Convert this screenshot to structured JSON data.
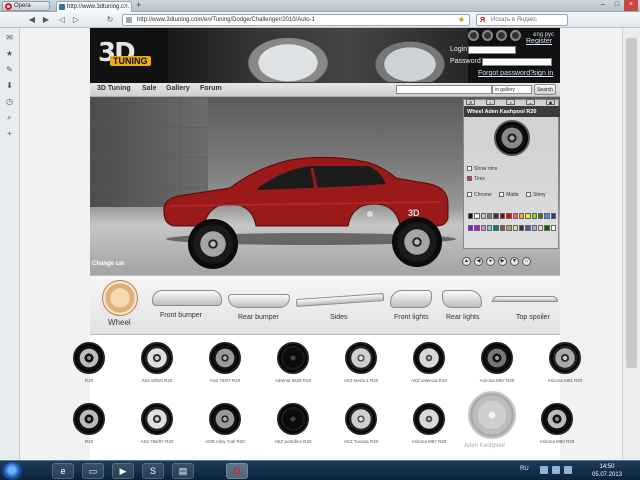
{
  "browser": {
    "menu_label": "Opera",
    "tab_title": "http://www.3dtuning.c...",
    "tab_close": "×",
    "new_tab": "+",
    "url": "http://www.3dtuning.com/en/Tuning/Dodge/Challenger/2010/Auto-1",
    "search_placeholder": "Искать в Яндекс",
    "win_min": "–",
    "win_max": "□",
    "win_close": "×",
    "nav_back": "◀",
    "nav_forward": "▶",
    "nav_rewind": "◁",
    "nav_ff": "▷",
    "nav_reload": "↻"
  },
  "sidebar": {
    "icons": [
      "opera-mail-icon",
      "bookmarks-icon",
      "notes-icon",
      "downloads-icon",
      "history-icon",
      "search-panel-icon",
      "add-panel-icon"
    ],
    "glyphs": [
      "✉",
      "★",
      "✎",
      "⬇",
      "◷",
      "⌕",
      "+"
    ]
  },
  "site": {
    "logo_number": "3D",
    "logo_text": "TUNING",
    "language": "eng  рус",
    "login_label": "Login",
    "password_label": "Password",
    "register_link": "Register",
    "forgot_link": "Forgot password?",
    "sign_in_link": "sign in",
    "menu": [
      "3D Tuning",
      "Sale",
      "Gallery",
      "Forum"
    ],
    "search_scope": "in gallery",
    "search_button": "Search",
    "change_car": "Change car",
    "zoom_controls": [
      "▲",
      "◀",
      "●",
      "▶",
      "▼",
      "⌂"
    ]
  },
  "wheel_panel": {
    "title": "Wheel Aden Kashpool R20",
    "tabs": [
      "⚙",
      "◐",
      "◑",
      "◒",
      "▣"
    ],
    "options": [
      "Show rims",
      "Tires"
    ],
    "finish": [
      "Chrome",
      "Matte",
      "Shiny"
    ],
    "colors": [
      "#111111",
      "#f2f2f2",
      "#c9c9c9",
      "#7a7a7a",
      "#3a3a3a",
      "#8b0000",
      "#d10b0b",
      "#ff5b5b",
      "#f5a623",
      "#f8e71c",
      "#7ed321",
      "#417505",
      "#4a90e2",
      "#1b3a8c",
      "#9013fe",
      "#bd10e0",
      "#ff7ac8",
      "#50e3c2",
      "#0b7a75",
      "#8b572a",
      "#c69c6d",
      "#e8d9b5",
      "#2c2c54",
      "#5c5c8a",
      "#a5a5ff",
      "#ffd1dc",
      "#006400",
      "#ffffff"
    ]
  },
  "categories": [
    {
      "label": "Wheel"
    },
    {
      "label": "Front bumper"
    },
    {
      "label": "Rear bumper"
    },
    {
      "label": "Sides"
    },
    {
      "label": "Front lights"
    },
    {
      "label": "Rear lights"
    },
    {
      "label": "Top spoiler"
    }
  ],
  "wheels_row1": [
    {
      "label": "R20"
    },
    {
      "label": "ASs 5/05S R20"
    },
    {
      "label": "ASs 75/07 R20"
    },
    {
      "label": "Adrenal 5628 R20"
    },
    {
      "label": "AEZ Ixeria 1 R20"
    },
    {
      "label": "AEZ valencia R20"
    },
    {
      "label": "Arizona M67 R20"
    },
    {
      "label": "Arizona M81 R20"
    }
  ],
  "wheels_row2": [
    {
      "label": "R20"
    },
    {
      "label": "ASs 756/07 R20"
    },
    {
      "label": "AOE Alloy 7oel R20"
    },
    {
      "label": "AEZ portofino R20"
    },
    {
      "label": "AEZ Tucana R20"
    },
    {
      "label": "Arizona M87 R20"
    },
    {
      "label": "Arizona M80 R20"
    }
  ],
  "wheel_highlight": "Aden Kashpool",
  "taskbar": {
    "apps": [
      "ie-icon",
      "explorer-icon",
      "media-player-icon",
      "skype-icon",
      "archive-icon",
      "opera-icon"
    ],
    "glyphs": [
      "e",
      "▭",
      "▶",
      "S",
      "▤",
      "O"
    ],
    "language": "RU",
    "time": "14:50",
    "date": "05.07.2013"
  }
}
